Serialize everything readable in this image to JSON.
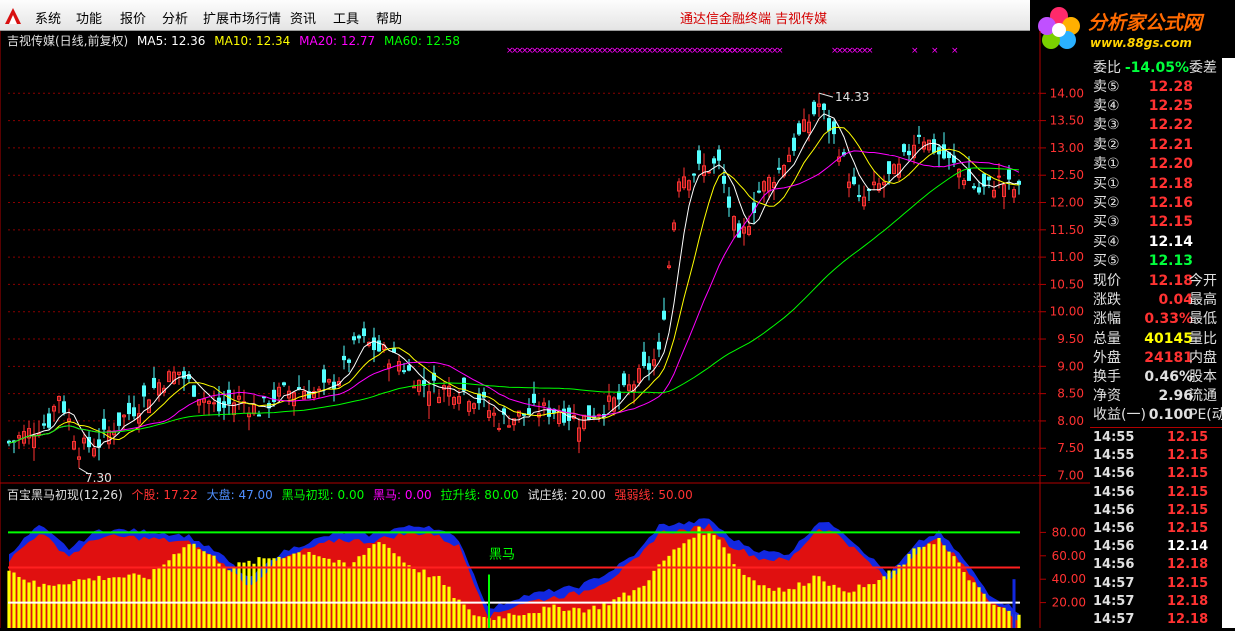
{
  "menu": {
    "items": [
      "系统",
      "功能",
      "报价",
      "分析",
      "扩展市场行情",
      "资讯",
      "工具",
      "帮助"
    ],
    "title": "通达信金融终端  吉视传媒"
  },
  "brand": {
    "name": "分析家公式网",
    "url": "www.88gs.com"
  },
  "colors": {
    "up": "#ff3232",
    "down": "#54ffff",
    "ma5": "#ffffff",
    "ma10": "#ffff00",
    "ma20": "#ff00ff",
    "ma60": "#00ff00",
    "grid": "#8a0000",
    "axis": "#b00000"
  },
  "main_chart": {
    "legend": {
      "title": "吉视传媒(日线,前复权)",
      "ma5": "MA5: 12.36",
      "ma10": "MA10: 12.34",
      "ma20": "MA20: 12.77",
      "ma60": "MA60: 12.58"
    },
    "high_label": "14.33",
    "low_label": "7.30",
    "y_ticks": [
      "14.00",
      "13.50",
      "13.00",
      "12.50",
      "12.00",
      "11.50",
      "11.00",
      "10.50",
      "10.00",
      "9.50",
      "9.00",
      "8.50",
      "8.00",
      "7.50",
      "7.00"
    ]
  },
  "indicator": {
    "legend": {
      "name": "百宝黑马初现(12,26)",
      "stock": "个股: 17.22",
      "market": "大盘: 47.00",
      "first": "黑马初现: 0.00",
      "horse": "黑马: 0.00",
      "rise": "拉升线: 80.00",
      "test": "试庄线: 20.00",
      "strong": "强弱线: 50.00"
    },
    "annotation": "黑马",
    "y_ticks": [
      "80.00",
      "60.00",
      "40.00",
      "20.00"
    ]
  },
  "quote": {
    "header": {
      "label": "委比",
      "value": "-14.05%",
      "extra": "委差"
    },
    "asks": [
      {
        "label": "卖⑤",
        "price": "12.28"
      },
      {
        "label": "卖④",
        "price": "12.25"
      },
      {
        "label": "卖③",
        "price": "12.22"
      },
      {
        "label": "卖②",
        "price": "12.21"
      },
      {
        "label": "卖①",
        "price": "12.20"
      }
    ],
    "bids": [
      {
        "label": "买①",
        "price": "12.18"
      },
      {
        "label": "买②",
        "price": "12.16"
      },
      {
        "label": "买③",
        "price": "12.15"
      },
      {
        "label": "买④",
        "price": "12.14"
      },
      {
        "label": "买⑤",
        "price": "12.13"
      }
    ],
    "stats": [
      {
        "label": "现价",
        "value": "12.18",
        "extra": "今开"
      },
      {
        "label": "涨跌",
        "value": "0.04",
        "extra": "最高"
      },
      {
        "label": "涨幅",
        "value": "0.33%",
        "extra": "最低"
      },
      {
        "label": "总量",
        "value": "40145",
        "extra": "量比"
      },
      {
        "label": "外盘",
        "value": "24181",
        "extra": "内盘"
      },
      {
        "label": "换手",
        "value": "0.46%",
        "extra": "股本"
      },
      {
        "label": "净资",
        "value": "2.96",
        "extra": "流通"
      },
      {
        "label": "收益(一)",
        "value": "0.100",
        "extra": "PE(动"
      }
    ],
    "ticks": [
      {
        "time": "14:55",
        "price": "12.15"
      },
      {
        "time": "14:55",
        "price": "12.15"
      },
      {
        "time": "14:56",
        "price": "12.15"
      },
      {
        "time": "14:56",
        "price": "12.15"
      },
      {
        "time": "14:56",
        "price": "12.15"
      },
      {
        "time": "14:56",
        "price": "12.15"
      },
      {
        "time": "14:56",
        "price": "12.14"
      },
      {
        "time": "14:56",
        "price": "12.18"
      },
      {
        "time": "14:57",
        "price": "12.15"
      },
      {
        "time": "14:57",
        "price": "12.18"
      },
      {
        "time": "14:57",
        "price": "12.18"
      }
    ]
  },
  "chart_data": {
    "type": "candlestick",
    "ylim": [
      6.9,
      14.5
    ],
    "anchors": [
      [
        0,
        7.6
      ],
      [
        8,
        8.0
      ],
      [
        10,
        8.5
      ],
      [
        14,
        7.5
      ],
      [
        18,
        7.6
      ],
      [
        22,
        8.0
      ],
      [
        26,
        8.3
      ],
      [
        30,
        8.7
      ],
      [
        34,
        8.9
      ],
      [
        38,
        8.5
      ],
      [
        42,
        8.2
      ],
      [
        46,
        8.4
      ],
      [
        50,
        8.2
      ],
      [
        54,
        8.5
      ],
      [
        58,
        8.6
      ],
      [
        62,
        8.5
      ],
      [
        66,
        8.8
      ],
      [
        70,
        9.5
      ],
      [
        74,
        9.3
      ],
      [
        78,
        9.1
      ],
      [
        82,
        8.7
      ],
      [
        86,
        8.6
      ],
      [
        90,
        8.6
      ],
      [
        94,
        8.4
      ],
      [
        98,
        8.0
      ],
      [
        102,
        8.1
      ],
      [
        106,
        8.2
      ],
      [
        110,
        8.2
      ],
      [
        114,
        8.0
      ],
      [
        118,
        8.2
      ],
      [
        122,
        8.4
      ],
      [
        126,
        8.8
      ],
      [
        130,
        9.2
      ],
      [
        134,
        12.5
      ],
      [
        138,
        12.6
      ],
      [
        142,
        12.7
      ],
      [
        146,
        11.2
      ],
      [
        150,
        12.2
      ],
      [
        154,
        12.6
      ],
      [
        158,
        13.2
      ],
      [
        162,
        13.8
      ],
      [
        166,
        13.0
      ],
      [
        170,
        12.0
      ],
      [
        174,
        12.3
      ],
      [
        178,
        12.6
      ],
      [
        182,
        13.3
      ],
      [
        186,
        12.9
      ],
      [
        190,
        12.6
      ],
      [
        194,
        12.2
      ],
      [
        198,
        12.4
      ],
      [
        202,
        12.2
      ]
    ],
    "indicator_ylim": [
      0,
      100
    ],
    "indicator_anchors": [
      [
        0,
        62
      ],
      [
        6,
        86
      ],
      [
        12,
        66
      ],
      [
        18,
        82
      ],
      [
        24,
        82
      ],
      [
        30,
        80
      ],
      [
        36,
        77
      ],
      [
        42,
        62
      ],
      [
        48,
        40
      ],
      [
        54,
        62
      ],
      [
        60,
        72
      ],
      [
        66,
        80
      ],
      [
        72,
        78
      ],
      [
        78,
        84
      ],
      [
        84,
        86
      ],
      [
        90,
        74
      ],
      [
        96,
        14
      ],
      [
        102,
        25
      ],
      [
        108,
        30
      ],
      [
        114,
        34
      ],
      [
        120,
        46
      ],
      [
        126,
        64
      ],
      [
        130,
        86
      ],
      [
        136,
        88
      ],
      [
        140,
        92
      ],
      [
        144,
        76
      ],
      [
        150,
        64
      ],
      [
        156,
        62
      ],
      [
        162,
        90
      ],
      [
        166,
        84
      ],
      [
        170,
        68
      ],
      [
        176,
        44
      ],
      [
        182,
        72
      ],
      [
        186,
        80
      ],
      [
        190,
        62
      ],
      [
        196,
        28
      ],
      [
        202,
        12
      ]
    ],
    "yellow_anchors": [
      [
        0,
        48
      ],
      [
        6,
        34
      ],
      [
        12,
        38
      ],
      [
        20,
        42
      ],
      [
        28,
        42
      ],
      [
        36,
        72
      ],
      [
        44,
        50
      ],
      [
        52,
        58
      ],
      [
        60,
        64
      ],
      [
        68,
        50
      ],
      [
        74,
        74
      ],
      [
        80,
        52
      ],
      [
        86,
        40
      ],
      [
        92,
        12
      ],
      [
        96,
        6
      ],
      [
        100,
        10
      ],
      [
        104,
        12
      ],
      [
        110,
        16
      ],
      [
        116,
        14
      ],
      [
        120,
        20
      ],
      [
        126,
        32
      ],
      [
        132,
        60
      ],
      [
        138,
        82
      ],
      [
        142,
        76
      ],
      [
        146,
        48
      ],
      [
        150,
        36
      ],
      [
        156,
        30
      ],
      [
        162,
        44
      ],
      [
        166,
        30
      ],
      [
        172,
        34
      ],
      [
        178,
        50
      ],
      [
        182,
        68
      ],
      [
        186,
        74
      ],
      [
        190,
        52
      ],
      [
        196,
        20
      ],
      [
        202,
        8
      ]
    ]
  }
}
